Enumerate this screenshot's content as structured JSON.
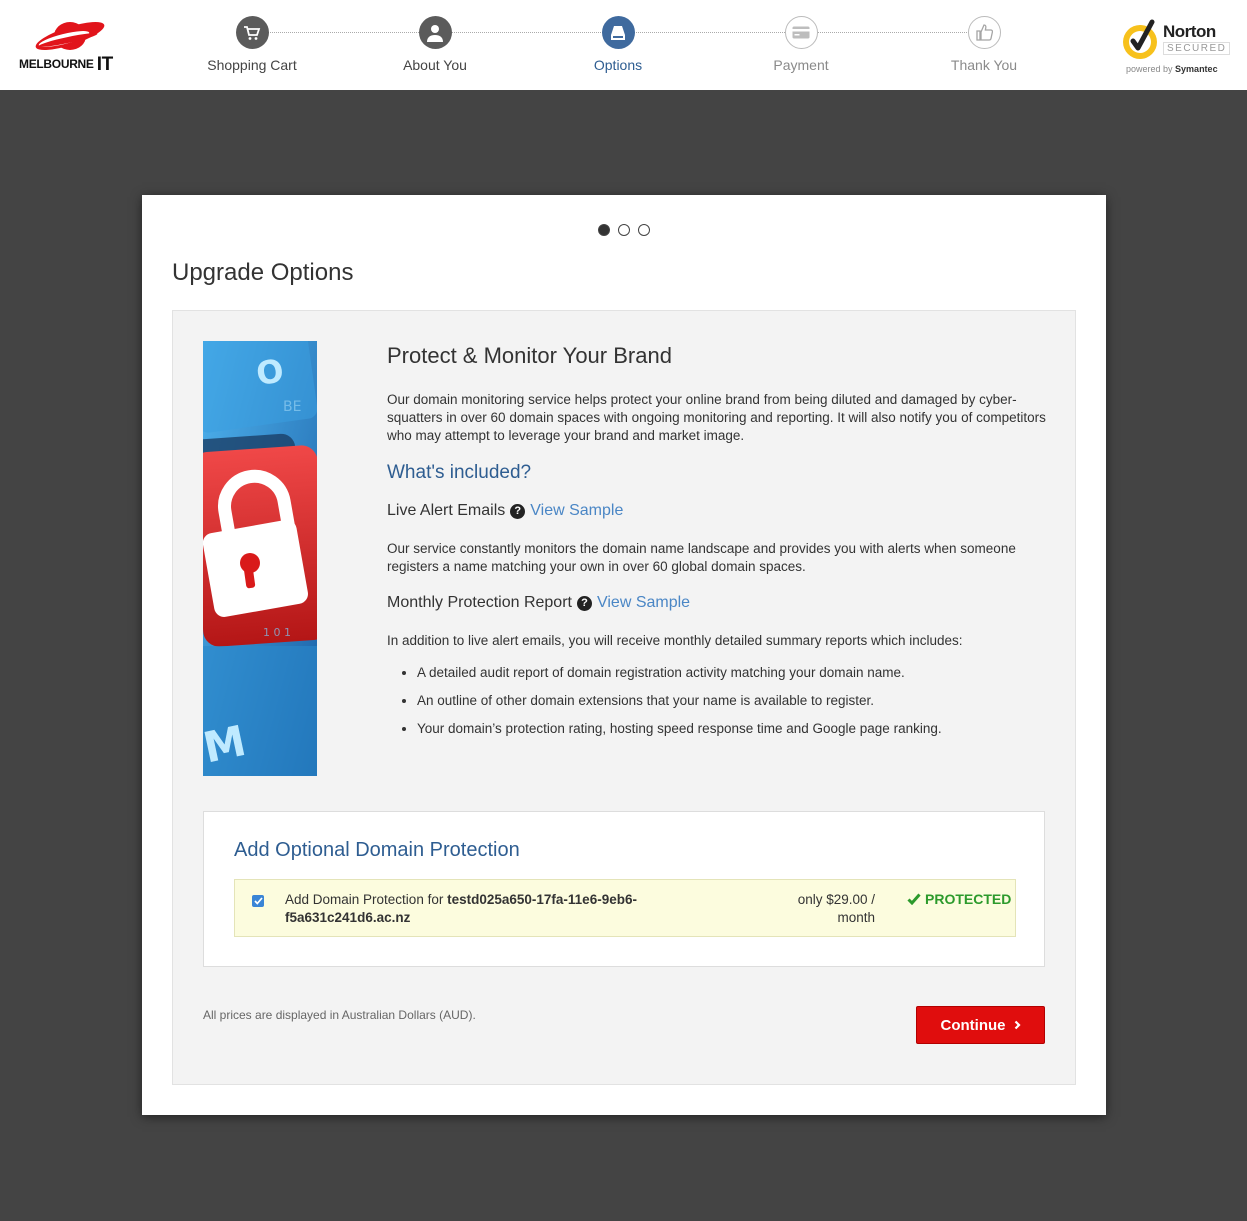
{
  "brand": {
    "logo_text_prefix": "MELBOURNE",
    "logo_text_suffix": "IT"
  },
  "steps": [
    {
      "label": "Shopping Cart",
      "icon": "cart-icon",
      "state": "done"
    },
    {
      "label": "About You",
      "icon": "user-icon",
      "state": "done"
    },
    {
      "label": "Options",
      "icon": "options-icon",
      "state": "active"
    },
    {
      "label": "Payment",
      "icon": "card-icon",
      "state": "future"
    },
    {
      "label": "Thank You",
      "icon": "thumbs-up-icon",
      "state": "future"
    }
  ],
  "norton": {
    "name": "Norton",
    "secured": "SECURED",
    "powered_by": "powered by",
    "vendor": "Symantec"
  },
  "carousel": {
    "total": 3,
    "active": 1
  },
  "modal": {
    "title": "Upgrade Options",
    "product_title": "Protect & Monitor Your Brand",
    "intro": "Our domain monitoring service helps protect your online brand from being diluted and damaged by cyber-squatters in over 60 domain spaces with ongoing monitoring and reporting. It will also notify you of competitors who may attempt to leverage your brand and market image.",
    "included_heading": "What's included?",
    "features": [
      {
        "name": "Live Alert Emails",
        "link": "View Sample",
        "description": "Our service constantly monitors the domain name landscape and provides you with alerts when someone registers a name matching your own in over 60 global domain spaces."
      },
      {
        "name": "Monthly Protection Report",
        "link": "View Sample",
        "description": "In addition to live alert emails, you will receive monthly detailed summary reports which includes:"
      }
    ],
    "bullets": [
      "A detailed audit report of domain registration activity matching your domain name.",
      "An outline of other domain extensions that your name is available to register.",
      "Your domain’s protection rating, hosting speed response time and Google page ranking."
    ],
    "protection": {
      "heading": "Add Optional Domain Protection",
      "label_prefix": "Add Domain Protection for ",
      "domain": "testd025a650-17fa-11e6-9eb6-f5a631c241d6.ac.nz",
      "price": "only $29.00 / month",
      "status": "PROTECTED",
      "checked": true
    },
    "currency_note": "All prices are displayed in Australian Dollars (AUD).",
    "continue_label": "Continue"
  },
  "colors": {
    "accent_blue": "#2e5d91",
    "link_blue": "#4a86c5",
    "button_red": "#e00d0d",
    "status_green": "#2c9a2c",
    "backdrop": "#444444"
  }
}
